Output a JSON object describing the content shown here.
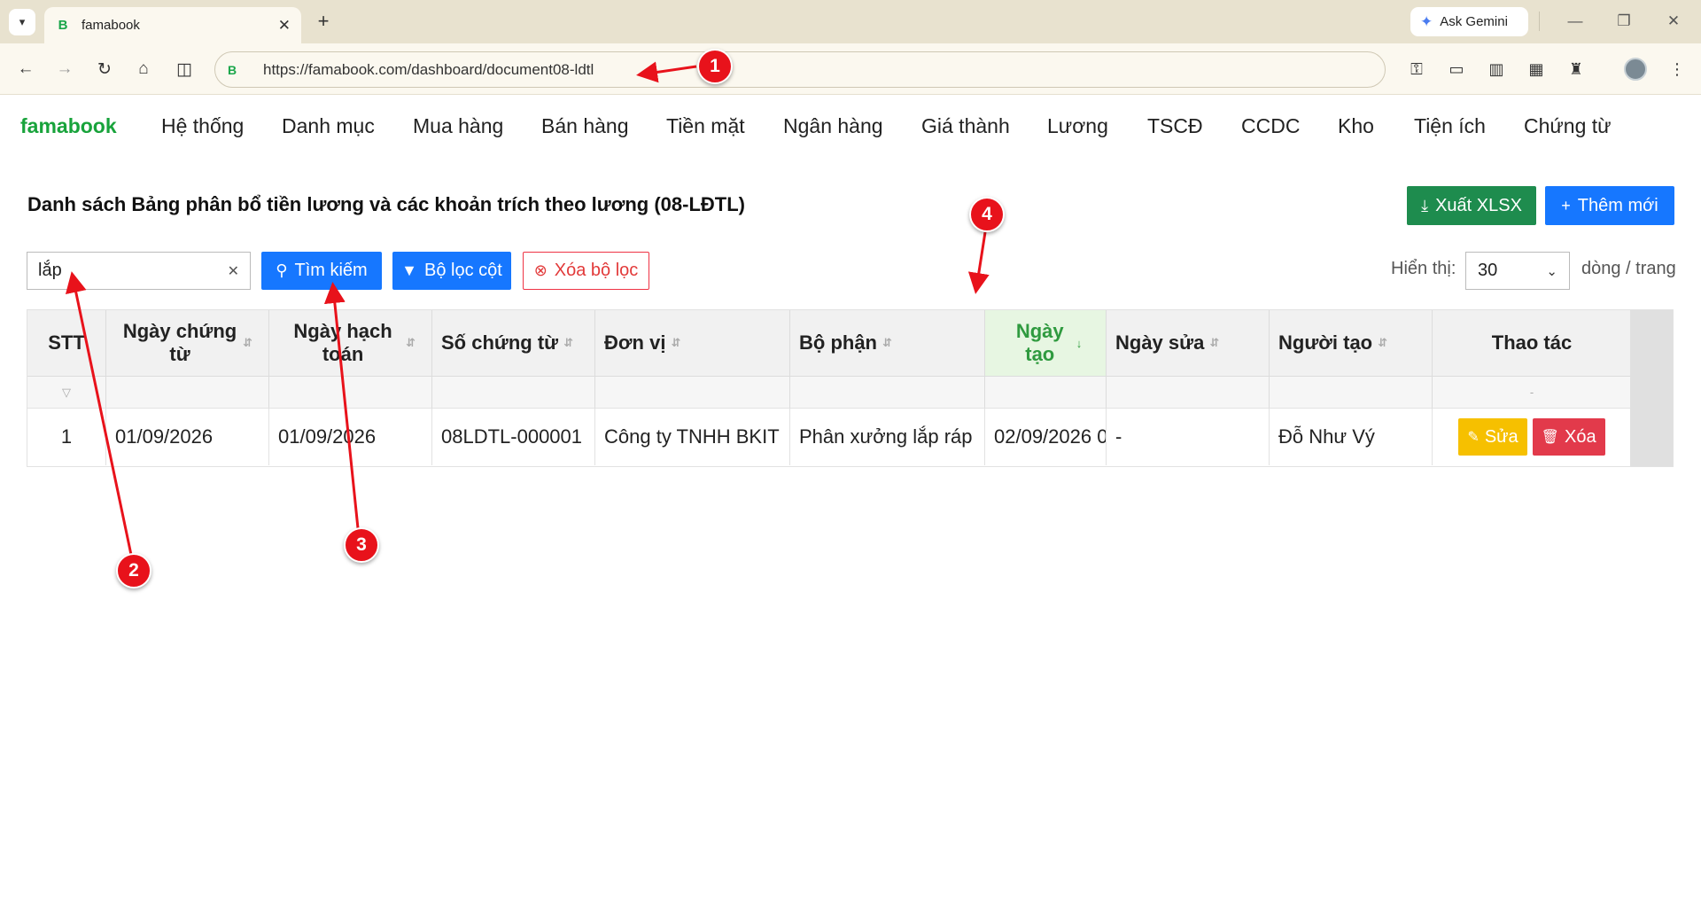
{
  "browser": {
    "tab_title": "famabook",
    "tab_favicon": "B",
    "url": "https://famabook.com/dashboard/document08-ldtl",
    "gemini_label": "Ask Gemini"
  },
  "app": {
    "brand": "famabook",
    "menu": [
      "Hệ thống",
      "Danh mục",
      "Mua hàng",
      "Bán hàng",
      "Tiền mặt",
      "Ngân hàng",
      "Giá thành",
      "Lương",
      "TSCĐ",
      "CCDC",
      "Kho",
      "Tiện ích",
      "Chứng từ"
    ]
  },
  "page": {
    "title": "Danh sách Bảng phân bổ tiền lương và các khoản trích theo lương (08-LĐTL)",
    "export_label": "Xuất XLSX",
    "add_label": "Thêm mới",
    "search_value": "lắp",
    "search_button": "Tìm kiếm",
    "column_filter_button": "Bộ lọc cột",
    "clear_filter_button": "Xóa bộ lọc",
    "show_label": "Hiển thị:",
    "page_size": "30",
    "per_page_label": "dòng / trang"
  },
  "table": {
    "headers": [
      "STT",
      "Ngày chứng từ",
      "Ngày hạch toán",
      "Số chứng từ",
      "Đơn vị",
      "Bộ phận",
      "Ngày tạo",
      "Ngày sửa",
      "Người tạo",
      "Thao tác"
    ],
    "filter_placeholder": "-",
    "rows": [
      {
        "stt": "1",
        "ngay_chung_tu": "01/09/2026",
        "ngay_hach_toan": "01/09/2026",
        "so_chung_tu": "08LDTL-000001",
        "don_vi": "Công ty TNHH BKIT",
        "bo_phan": "Phân xưởng lắp ráp",
        "ngay_tao": "02/09/2026 0",
        "ngay_sua": "-",
        "nguoi_tao": "Đỗ Như Vý",
        "edit_label": "Sửa",
        "delete_label": "Xóa"
      }
    ]
  },
  "annotations": {
    "markers": [
      "1",
      "2",
      "3",
      "4"
    ],
    "color": "#e8121b"
  },
  "colors": {
    "brand": "#18a33b",
    "primary": "#1677ff",
    "export": "#1e8c4e",
    "danger": "#e23a4b",
    "warning": "#f6c000"
  }
}
